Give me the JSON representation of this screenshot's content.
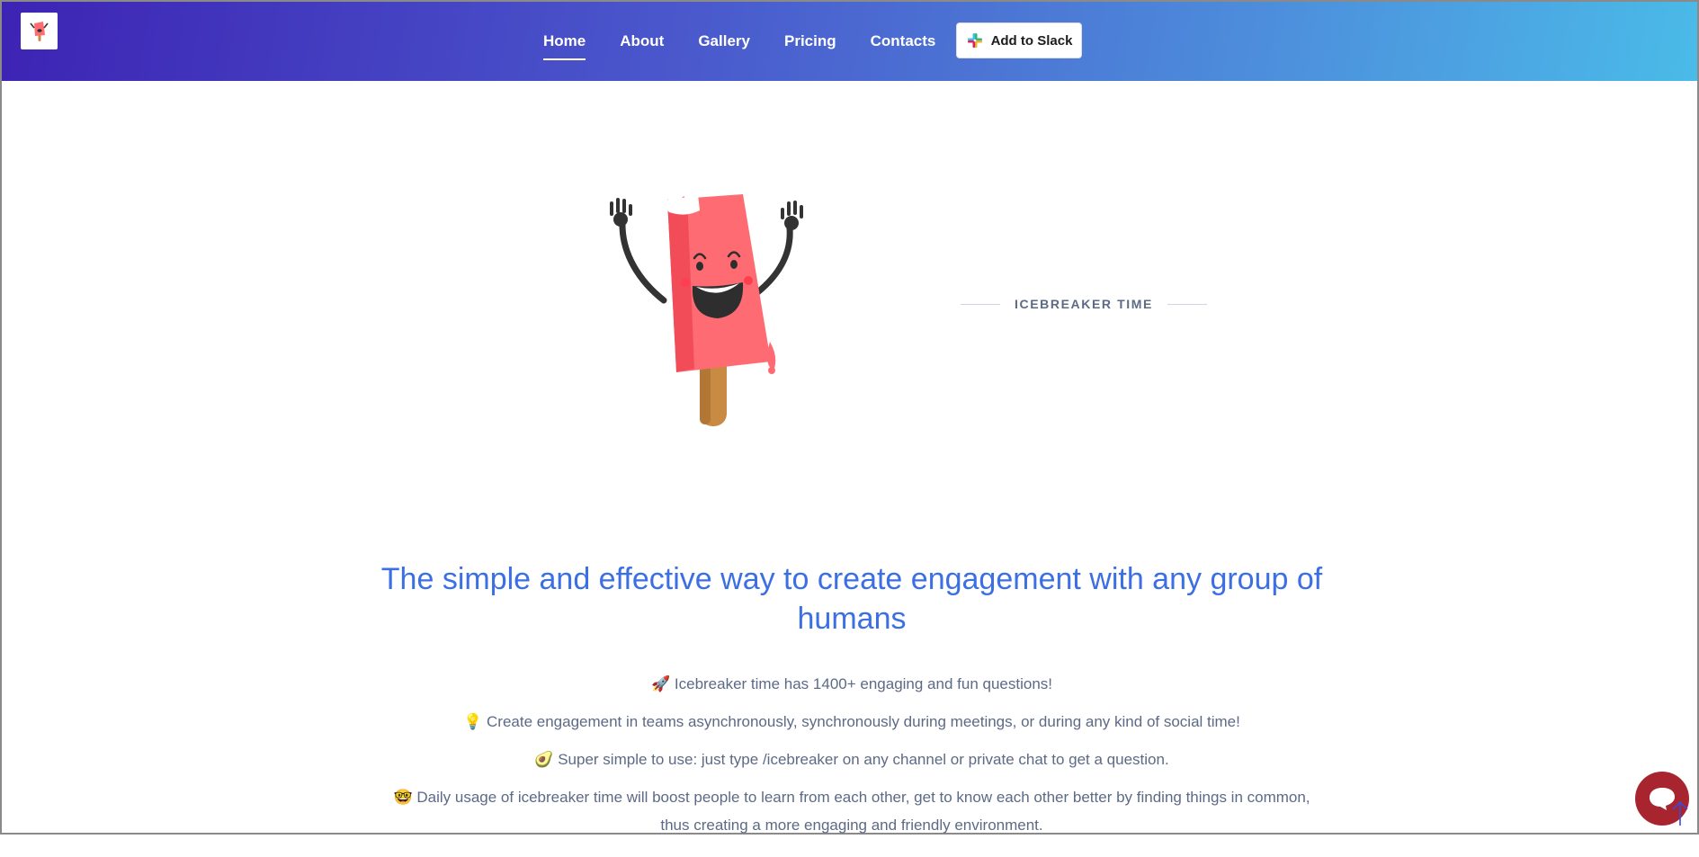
{
  "nav": {
    "logo_icon": "popsicle-logo-icon",
    "links": [
      {
        "label": "Home",
        "active": true
      },
      {
        "label": "About",
        "active": false
      },
      {
        "label": "Gallery",
        "active": false
      },
      {
        "label": "Pricing",
        "active": false
      },
      {
        "label": "Contacts",
        "active": false
      }
    ],
    "slack_button": {
      "label": "Add to Slack",
      "icon": "slack-icon"
    }
  },
  "hero": {
    "mascot_icon": "popsicle-mascot-illustration",
    "tagline": "ICEBREAKER TIME"
  },
  "main": {
    "headline": "The simple and effective way to create engagement with any group of humans",
    "features": [
      {
        "emoji": "🚀",
        "text": "Icebreaker time has 1400+ engaging and fun questions!"
      },
      {
        "emoji": "💡",
        "text": "Create engagement in teams asynchronously, synchronously during meetings, or during any kind of social time!"
      },
      {
        "emoji": "🥑",
        "text": "Super simple to use: just type /icebreaker on any channel or private chat to get a question."
      },
      {
        "emoji": "🤓",
        "text": "Daily usage of icebreaker time will boost people to learn from each other, get to know each other better by finding things in common, thus creating a more engaging and friendly environment."
      }
    ]
  },
  "widgets": {
    "chat_icon": "chat-bubble-icon",
    "scroll_top_icon": "arrow-up-icon"
  },
  "colors": {
    "header_gradient_start": "#3d23b4",
    "header_gradient_end": "#4abbe8",
    "headline": "#3b6fe3",
    "body_text": "#5d6a85",
    "popsicle": "#ff6b72",
    "chat_button": "#a8242f"
  }
}
